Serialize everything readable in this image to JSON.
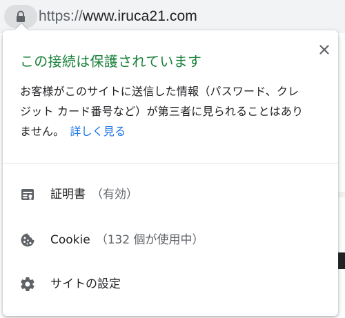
{
  "omnibox": {
    "url_scheme": "https://",
    "url_host": "www.iruca21.com",
    "lock_icon": "lock-icon"
  },
  "popup": {
    "title": "この接続は保護されています",
    "description_lines": [
      "お客様がこのサイトに送信した情報（パスワード、クレ",
      "ジット カード番号など）が第三者に見られることはあり",
      "ません。"
    ],
    "learn_more": "詳しく見る",
    "close_icon": "close-icon",
    "items": [
      {
        "label": "証明書",
        "sub": "（有効）",
        "icon": "certificate-icon"
      },
      {
        "label": "Cookie",
        "sub": "（132 個が使用中）",
        "icon": "cookie-icon"
      },
      {
        "label": "サイトの設定",
        "sub": "",
        "icon": "gear-icon"
      }
    ]
  },
  "colors": {
    "secure_green": "#188038",
    "link_blue": "#1a73e8",
    "text": "#202124",
    "secondary_text": "#5f6368",
    "icon": "#5f6368"
  }
}
